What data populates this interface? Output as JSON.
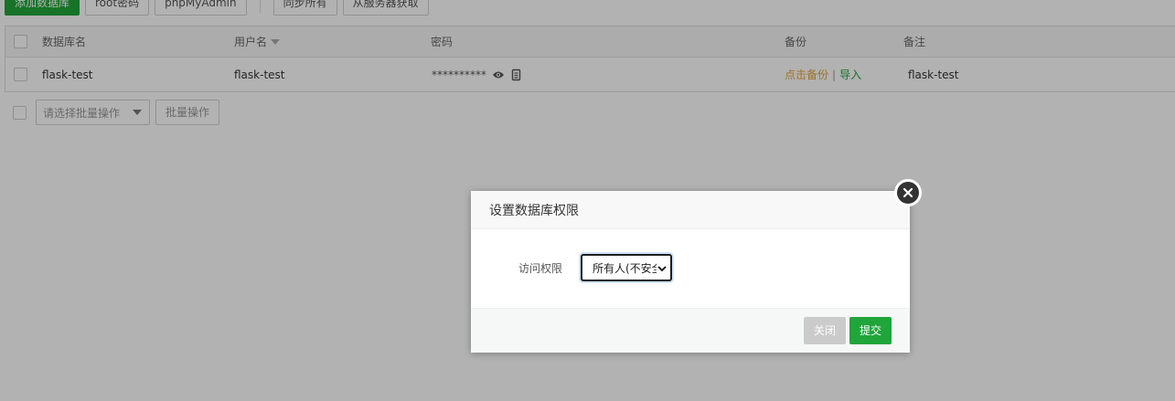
{
  "toolbar": {
    "add_db": "添加数据库",
    "root_pw": "root密码",
    "phpmyadmin": "phpMyAdmin",
    "sync_all": "同步所有",
    "fetch_server": "从服务器获取"
  },
  "table": {
    "headers": {
      "name": "数据库名",
      "user": "用户名",
      "password": "密码",
      "backup": "备份",
      "note": "备注"
    },
    "rows": [
      {
        "name": "flask-test",
        "user": "flask-test",
        "password_mask": "**********",
        "backup_link": "点击备份",
        "import_link": "导入",
        "sep": "|",
        "note": "flask-test"
      }
    ]
  },
  "batch": {
    "placeholder": "请选择批量操作",
    "button": "批量操作"
  },
  "modal": {
    "title": "设置数据库权限",
    "field_label": "访问权限",
    "select_value": "所有人(不安全)",
    "close": "关闭",
    "submit": "提交"
  },
  "colors": {
    "brand_green": "#20a53a",
    "backup_orange": "#e4a434",
    "close_gray": "#cbcbcb"
  },
  "icons": {
    "show_password": "eye-icon",
    "copy_password": "copy-icon",
    "modal_close": "close-circle-icon",
    "sort": "caret-down-icon",
    "select_arrow": "chevron-down-icon"
  }
}
